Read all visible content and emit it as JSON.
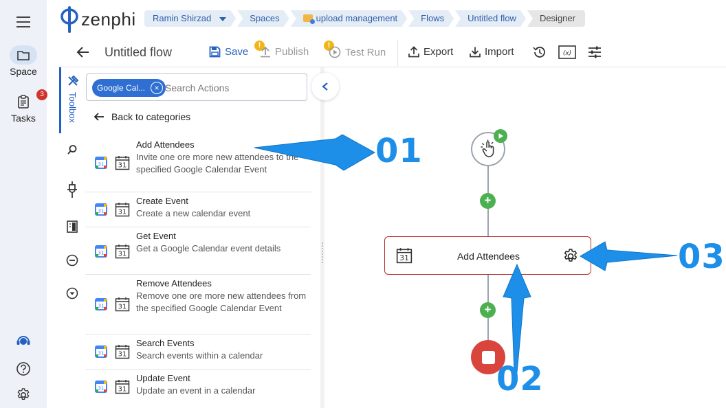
{
  "rail": {
    "space_label": "Space",
    "tasks_label": "Tasks",
    "tasks_badge": "3"
  },
  "logo": {
    "text": "zenphi"
  },
  "breadcrumb": {
    "items": [
      "Ramin Shirzad",
      "Spaces",
      "upload management",
      "Flows",
      "Untitled flow",
      "Designer"
    ]
  },
  "toolbar": {
    "title": "Untitled flow",
    "save_label": "Save",
    "publish_label": "Publish",
    "test_run_label": "Test Run",
    "export_label": "Export",
    "import_label": "Import",
    "warning_symbol": "!"
  },
  "sidebar": {
    "toolbox_label": "Toolbox"
  },
  "search": {
    "chip_label": "Google Cal...",
    "placeholder": "Search Actions"
  },
  "back_to_categories": "Back to categories",
  "actions": [
    {
      "name": "Add Attendees",
      "desc": "Invite one ore more new attendees to the specified Google Calendar Event"
    },
    {
      "name": "Create Event",
      "desc": "Create a new calendar event"
    },
    {
      "name": "Get Event",
      "desc": "Get a Google Calendar event details"
    },
    {
      "name": "Remove Attendees",
      "desc": "Remove one ore more new attendees from the specified Google Calendar Event"
    },
    {
      "name": "Search Events",
      "desc": "Search events within a calendar"
    },
    {
      "name": "Update Event",
      "desc": "Update an event in a calendar"
    }
  ],
  "canvas": {
    "step_label": "Add Attendees",
    "plus_symbol": "+"
  },
  "annotations": {
    "label_1": "01",
    "label_2": "02",
    "label_3": "03"
  },
  "colors": {
    "accent": "#2461c2",
    "annotation": "#1d8fe8",
    "step_border": "#b62a2a",
    "stop": "#d9453c",
    "add": "#4caf50"
  }
}
